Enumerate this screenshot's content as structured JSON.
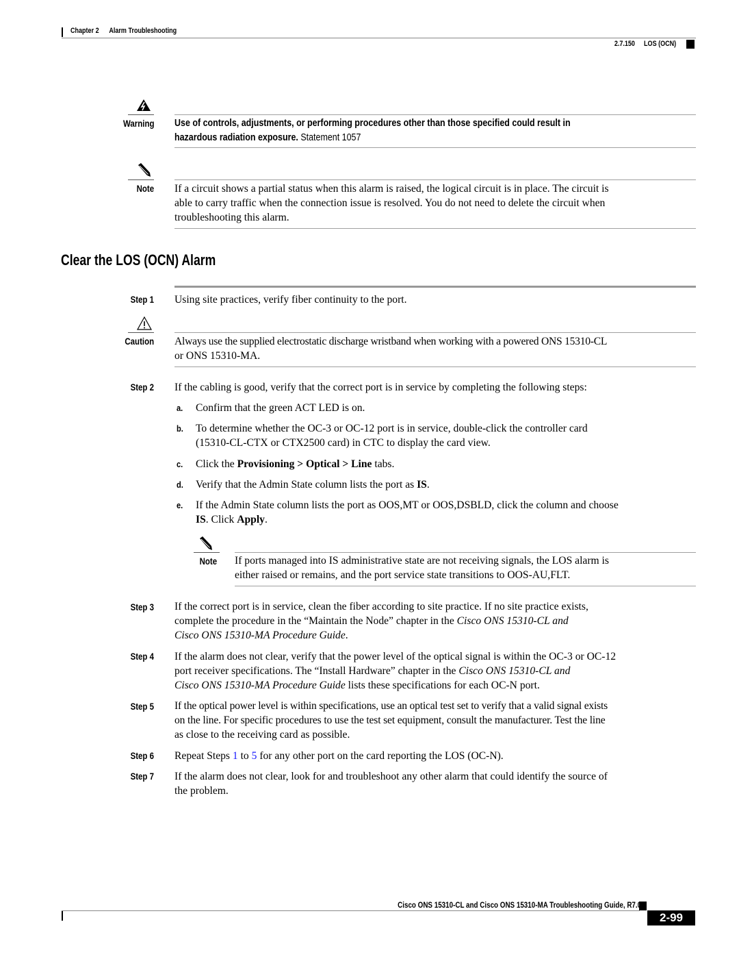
{
  "header": {
    "chapter_label": "Chapter 2",
    "chapter_title": "Alarm Troubleshooting",
    "section_number": "2.7.150",
    "section_title": "LOS (OCN)"
  },
  "warning": {
    "icon": "warning-lightning-icon",
    "label": "Warning",
    "line1": "Use of controls, adjustments, or performing procedures other than those specified could result in",
    "line2_bold": "hazardous radiation exposure.",
    "line2_statement": " Statement 1057"
  },
  "note1": {
    "icon": "note-pencil-icon",
    "label": "Note",
    "lines": [
      "If a circuit shows a partial status when this alarm is raised, the logical circuit is in place. The circuit is",
      "able to carry traffic when the connection issue is resolved. You do not need to delete the circuit when",
      "troubleshooting this alarm."
    ]
  },
  "section": {
    "heading": "Clear the LOS (OCN) Alarm"
  },
  "steps": {
    "step1": {
      "label": "Step 1",
      "text": "Using site practices, verify fiber continuity to the port."
    },
    "caution": {
      "icon": "caution-triangle-icon",
      "label": "Caution",
      "lines": [
        "Always use the supplied electrostatic discharge wristband when working with a powered ONS 15310-CL",
        "or ONS 15310-MA."
      ]
    },
    "step2": {
      "label": "Step 2",
      "text": "If the cabling is good, verify that the correct port is in service by completing the following steps:",
      "substeps": {
        "a": {
          "label": "a.",
          "text": "Confirm that the green ACT LED is on."
        },
        "b": {
          "label": "b.",
          "line1": "To determine whether the OC-3 or OC-12 port is in service, double-click the controller card",
          "line2": "(15310-CL-CTX or CTX2500 card) in CTC to display the card view."
        },
        "c": {
          "label": "c.",
          "pre": "Click the ",
          "bold": "Provisioning > Optical > Line",
          "post": " tabs."
        },
        "d": {
          "label": "d.",
          "pre": "Verify that the Admin State column lists the port as ",
          "bold": "IS",
          "post": "."
        },
        "e": {
          "label": "e.",
          "line1": "If the Admin State column lists the port as OOS,MT or OOS,DSBLD, click the column and choose",
          "bold1": "IS",
          "mid": ". Click ",
          "bold2": "Apply",
          "end": "."
        }
      },
      "note": {
        "icon": "note-pencil-icon",
        "label": "Note",
        "lines": [
          "If ports managed into IS administrative state are not receiving signals, the LOS alarm is",
          "either raised or remains, and the port service state transitions to OOS-AU,FLT."
        ]
      }
    },
    "step3": {
      "label": "Step 3",
      "line1": "If the correct port is in service, clean the fiber according to site practice. If no site practice exists,",
      "line2_pre": "complete the procedure in the “Maintain the Node” chapter in the ",
      "line2_italic": "Cisco ONS 15310-CL and",
      "line3_italic": "Cisco ONS 15310-MA Procedure Guide",
      "line3_post": "."
    },
    "step4": {
      "label": "Step 4",
      "line1": "If the alarm does not clear, verify that the power level of the optical signal is within the OC-3 or OC-12",
      "line2_pre": "port receiver specifications. The “Install Hardware” chapter in the ",
      "line2_italic": "Cisco ONS 15310-CL and",
      "line3_italic": "Cisco ONS 15310-MA Procedure Guide",
      "line3_post": " lists these specifications for each OC-N port."
    },
    "step5": {
      "label": "Step 5",
      "lines": [
        "If the optical power level is within specifications, use an optical test set to verify that a valid signal exists",
        "on the line. For specific procedures to use the test set equipment, consult the manufacturer. Test the line",
        "as close to the receiving card as possible."
      ]
    },
    "step6": {
      "label": "Step 6",
      "pre": "Repeat Steps ",
      "link1": "1",
      "mid": " to ",
      "link2": "5",
      "post": " for any other port on the card reporting the LOS (OC-N)."
    },
    "step7": {
      "label": "Step 7",
      "lines": [
        "If the alarm does not clear, look for and troubleshoot any other alarm that could identify the source of",
        "the problem."
      ]
    }
  },
  "footer": {
    "guide_title": "Cisco ONS 15310-CL and Cisco ONS 15310-MA Troubleshooting Guide, R7.0",
    "page_number": "2-99"
  },
  "colors": {
    "link": "#1a1aff",
    "rule": "#a0a0a0",
    "text": "#000000"
  }
}
